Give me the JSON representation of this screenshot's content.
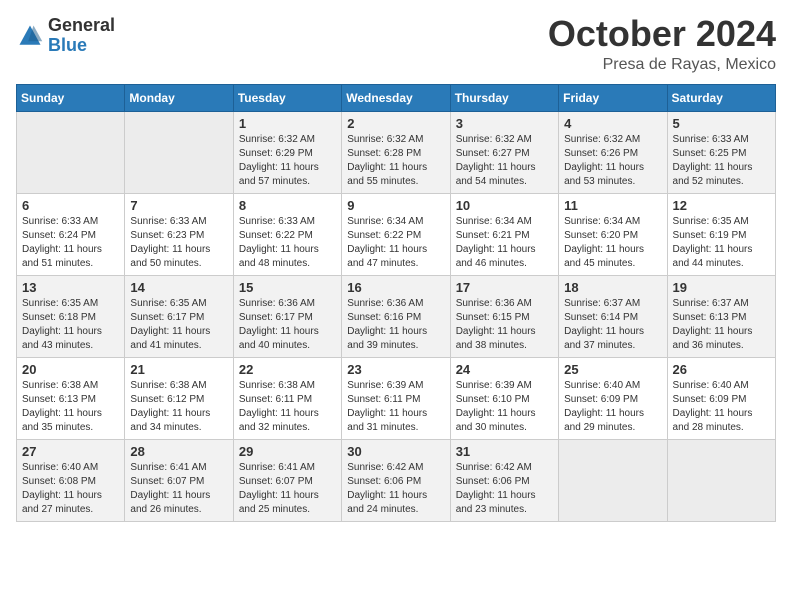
{
  "header": {
    "logo_general": "General",
    "logo_blue": "Blue",
    "month_title": "October 2024",
    "location": "Presa de Rayas, Mexico"
  },
  "days_of_week": [
    "Sunday",
    "Monday",
    "Tuesday",
    "Wednesday",
    "Thursday",
    "Friday",
    "Saturday"
  ],
  "weeks": [
    [
      {
        "day": "",
        "text": ""
      },
      {
        "day": "",
        "text": ""
      },
      {
        "day": "1",
        "text": "Sunrise: 6:32 AM\nSunset: 6:29 PM\nDaylight: 11 hours and 57 minutes."
      },
      {
        "day": "2",
        "text": "Sunrise: 6:32 AM\nSunset: 6:28 PM\nDaylight: 11 hours and 55 minutes."
      },
      {
        "day": "3",
        "text": "Sunrise: 6:32 AM\nSunset: 6:27 PM\nDaylight: 11 hours and 54 minutes."
      },
      {
        "day": "4",
        "text": "Sunrise: 6:32 AM\nSunset: 6:26 PM\nDaylight: 11 hours and 53 minutes."
      },
      {
        "day": "5",
        "text": "Sunrise: 6:33 AM\nSunset: 6:25 PM\nDaylight: 11 hours and 52 minutes."
      }
    ],
    [
      {
        "day": "6",
        "text": "Sunrise: 6:33 AM\nSunset: 6:24 PM\nDaylight: 11 hours and 51 minutes."
      },
      {
        "day": "7",
        "text": "Sunrise: 6:33 AM\nSunset: 6:23 PM\nDaylight: 11 hours and 50 minutes."
      },
      {
        "day": "8",
        "text": "Sunrise: 6:33 AM\nSunset: 6:22 PM\nDaylight: 11 hours and 48 minutes."
      },
      {
        "day": "9",
        "text": "Sunrise: 6:34 AM\nSunset: 6:22 PM\nDaylight: 11 hours and 47 minutes."
      },
      {
        "day": "10",
        "text": "Sunrise: 6:34 AM\nSunset: 6:21 PM\nDaylight: 11 hours and 46 minutes."
      },
      {
        "day": "11",
        "text": "Sunrise: 6:34 AM\nSunset: 6:20 PM\nDaylight: 11 hours and 45 minutes."
      },
      {
        "day": "12",
        "text": "Sunrise: 6:35 AM\nSunset: 6:19 PM\nDaylight: 11 hours and 44 minutes."
      }
    ],
    [
      {
        "day": "13",
        "text": "Sunrise: 6:35 AM\nSunset: 6:18 PM\nDaylight: 11 hours and 43 minutes."
      },
      {
        "day": "14",
        "text": "Sunrise: 6:35 AM\nSunset: 6:17 PM\nDaylight: 11 hours and 41 minutes."
      },
      {
        "day": "15",
        "text": "Sunrise: 6:36 AM\nSunset: 6:17 PM\nDaylight: 11 hours and 40 minutes."
      },
      {
        "day": "16",
        "text": "Sunrise: 6:36 AM\nSunset: 6:16 PM\nDaylight: 11 hours and 39 minutes."
      },
      {
        "day": "17",
        "text": "Sunrise: 6:36 AM\nSunset: 6:15 PM\nDaylight: 11 hours and 38 minutes."
      },
      {
        "day": "18",
        "text": "Sunrise: 6:37 AM\nSunset: 6:14 PM\nDaylight: 11 hours and 37 minutes."
      },
      {
        "day": "19",
        "text": "Sunrise: 6:37 AM\nSunset: 6:13 PM\nDaylight: 11 hours and 36 minutes."
      }
    ],
    [
      {
        "day": "20",
        "text": "Sunrise: 6:38 AM\nSunset: 6:13 PM\nDaylight: 11 hours and 35 minutes."
      },
      {
        "day": "21",
        "text": "Sunrise: 6:38 AM\nSunset: 6:12 PM\nDaylight: 11 hours and 34 minutes."
      },
      {
        "day": "22",
        "text": "Sunrise: 6:38 AM\nSunset: 6:11 PM\nDaylight: 11 hours and 32 minutes."
      },
      {
        "day": "23",
        "text": "Sunrise: 6:39 AM\nSunset: 6:11 PM\nDaylight: 11 hours and 31 minutes."
      },
      {
        "day": "24",
        "text": "Sunrise: 6:39 AM\nSunset: 6:10 PM\nDaylight: 11 hours and 30 minutes."
      },
      {
        "day": "25",
        "text": "Sunrise: 6:40 AM\nSunset: 6:09 PM\nDaylight: 11 hours and 29 minutes."
      },
      {
        "day": "26",
        "text": "Sunrise: 6:40 AM\nSunset: 6:09 PM\nDaylight: 11 hours and 28 minutes."
      }
    ],
    [
      {
        "day": "27",
        "text": "Sunrise: 6:40 AM\nSunset: 6:08 PM\nDaylight: 11 hours and 27 minutes."
      },
      {
        "day": "28",
        "text": "Sunrise: 6:41 AM\nSunset: 6:07 PM\nDaylight: 11 hours and 26 minutes."
      },
      {
        "day": "29",
        "text": "Sunrise: 6:41 AM\nSunset: 6:07 PM\nDaylight: 11 hours and 25 minutes."
      },
      {
        "day": "30",
        "text": "Sunrise: 6:42 AM\nSunset: 6:06 PM\nDaylight: 11 hours and 24 minutes."
      },
      {
        "day": "31",
        "text": "Sunrise: 6:42 AM\nSunset: 6:06 PM\nDaylight: 11 hours and 23 minutes."
      },
      {
        "day": "",
        "text": ""
      },
      {
        "day": "",
        "text": ""
      }
    ]
  ]
}
